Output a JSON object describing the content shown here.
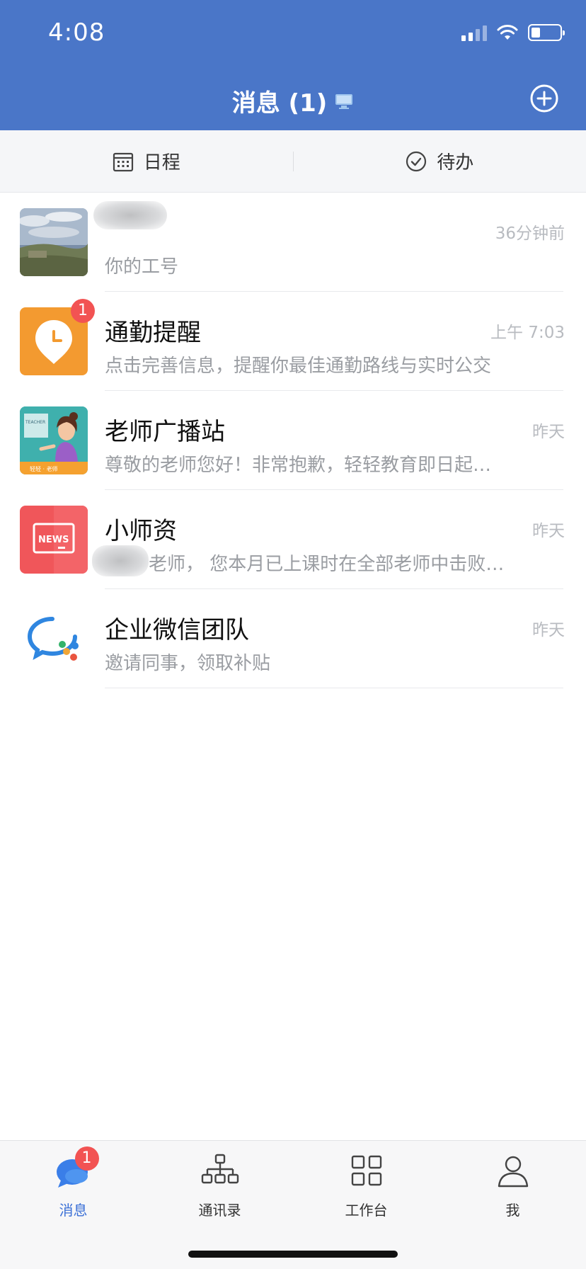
{
  "status_bar": {
    "time": "4:08"
  },
  "header": {
    "title": "消息 (1)"
  },
  "subtabs": [
    {
      "label": "日程",
      "icon": "calendar-icon"
    },
    {
      "label": "待办",
      "icon": "check-circle-icon"
    }
  ],
  "conversations": [
    {
      "name": "",
      "preview": "你的工号",
      "time": "36分钟前",
      "badge": ""
    },
    {
      "name": "通勤提醒",
      "preview": "点击完善信息，提醒你最佳通勤路线与实时公交",
      "time": "上午 7:03",
      "badge": "1"
    },
    {
      "name": "老师广播站",
      "preview": "尊敬的老师您好！非常抱歉，轻轻教育即日起…",
      "time": "昨天",
      "badge": ""
    },
    {
      "name": "小师资",
      "preview": "老师，  您本月已上课时在全部老师中击败…",
      "time": "昨天",
      "badge": ""
    },
    {
      "name": "企业微信团队",
      "preview": "邀请同事，领取补贴",
      "time": "昨天",
      "badge": ""
    }
  ],
  "avatars": {
    "teacher_text": "TEACHER",
    "teacher_brand": "轻轻 · 老师",
    "news_text": "NEWS"
  },
  "tabbar": {
    "items": [
      {
        "label": "消息",
        "icon": "chat-bubble-icon",
        "badge": "1",
        "active": true
      },
      {
        "label": "通讯录",
        "icon": "org-chart-icon"
      },
      {
        "label": "工作台",
        "icon": "grid-icon"
      },
      {
        "label": "我",
        "icon": "person-icon"
      }
    ]
  },
  "colors": {
    "header_bg": "#4a76c8",
    "accent": "#3a6fd6",
    "badge": "#f25353"
  }
}
